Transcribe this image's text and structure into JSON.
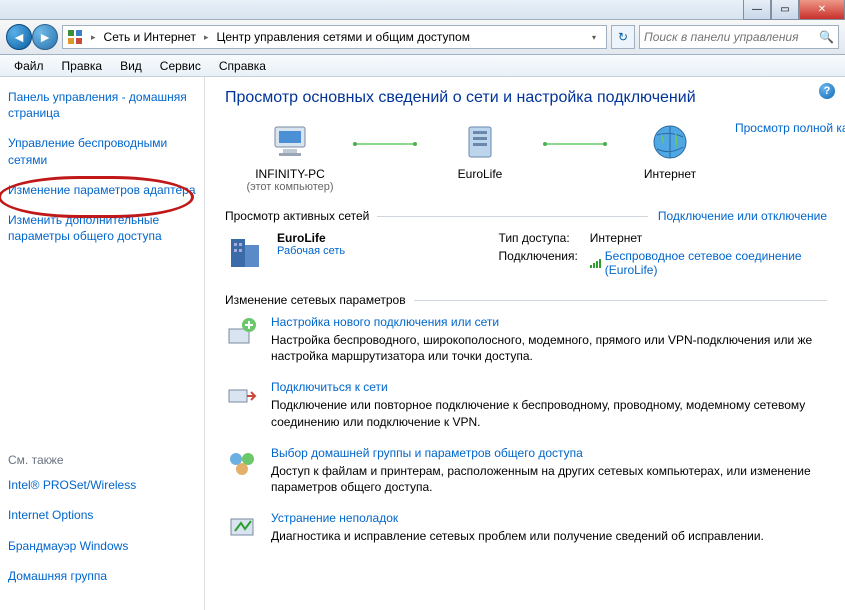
{
  "titlebar": {
    "min": "—",
    "max": "▭",
    "close": "✕"
  },
  "nav": {
    "path_parts": [
      "Сеть и Интернет",
      "Центр управления сетями и общим доступом"
    ],
    "search_placeholder": "Поиск в панели управления",
    "back_glyph": "◄",
    "fwd_glyph": "►",
    "refresh_glyph": "↻",
    "sep_glyph": "▸",
    "search_glyph": "🔍"
  },
  "menu": [
    "Файл",
    "Правка",
    "Вид",
    "Сервис",
    "Справка"
  ],
  "sidebar": {
    "links": [
      "Панель управления - домашняя страница",
      "Управление беспроводными сетями",
      "Изменение параметров адаптера",
      "Изменить дополнительные параметры общего доступа"
    ],
    "see_also_label": "См. также",
    "see_also": [
      "Intel® PROSet/Wireless",
      "Internet Options",
      "Брандмауэр Windows",
      "Домашняя группа"
    ]
  },
  "main": {
    "title": "Просмотр основных сведений о сети и настройка подключений",
    "help_glyph": "?",
    "nodes": [
      {
        "label": "INFINITY-PC",
        "sub": "(этот компьютер)"
      },
      {
        "label": "EuroLife",
        "sub": ""
      },
      {
        "label": "Интернет",
        "sub": ""
      }
    ],
    "full_map": "Просмотр полной карты",
    "active_header": "Просмотр активных сетей",
    "active_action": "Подключение или отключение",
    "active_net": {
      "name": "EuroLife",
      "type": "Рабочая сеть",
      "rows": [
        {
          "k": "Тип доступа:",
          "v": "Интернет",
          "link": false
        },
        {
          "k": "Подключения:",
          "v": "Беспроводное сетевое соединение (EuroLife)",
          "link": true
        }
      ]
    },
    "change_header": "Изменение сетевых параметров",
    "tasks": [
      {
        "title": "Настройка нового подключения или сети",
        "desc": "Настройка беспроводного, широкополосного, модемного, прямого или VPN-подключения или же настройка маршрутизатора или точки доступа."
      },
      {
        "title": "Подключиться к сети",
        "desc": "Подключение или повторное подключение к беспроводному, проводному, модемному сетевому соединению или подключение к VPN."
      },
      {
        "title": "Выбор домашней группы и параметров общего доступа",
        "desc": "Доступ к файлам и принтерам, расположенным на других сетевых компьютерах, или изменение параметров общего доступа."
      },
      {
        "title": "Устранение неполадок",
        "desc": "Диагностика и исправление сетевых проблем или получение сведений об исправлении."
      }
    ]
  }
}
